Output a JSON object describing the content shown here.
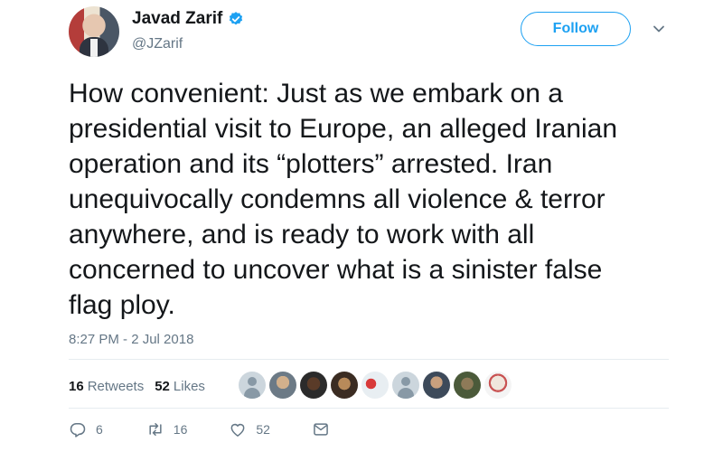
{
  "header": {
    "name": "Javad Zarif",
    "handle": "@JZarif",
    "follow_label": "Follow"
  },
  "tweet": {
    "text": "How convenient: Just as we embark on a\npresidential visit to Europe, an alleged Iranian\noperation and its “plotters” arrested. Iran\nunequivocally condemns all violence & terror\nanywhere, and is ready to work with all\nconcerned to uncover what is a sinister false\nflag ploy.",
    "timestamp": "8:27 PM - 2 Jul 2018"
  },
  "stats": {
    "retweets_count": "16",
    "retweets_label": "Retweets",
    "likes_count": "52",
    "likes_label": "Likes"
  },
  "actions": {
    "reply_count": "6",
    "retweet_count": "16",
    "like_count": "52"
  },
  "colors": {
    "accent": "#1da1f2",
    "secondary_text": "#657786",
    "retweet": "#17bf63"
  },
  "icons": [
    "verified-badge-icon",
    "chevron-down-icon",
    "reply-icon",
    "retweet-icon",
    "like-icon",
    "direct-message-icon"
  ]
}
